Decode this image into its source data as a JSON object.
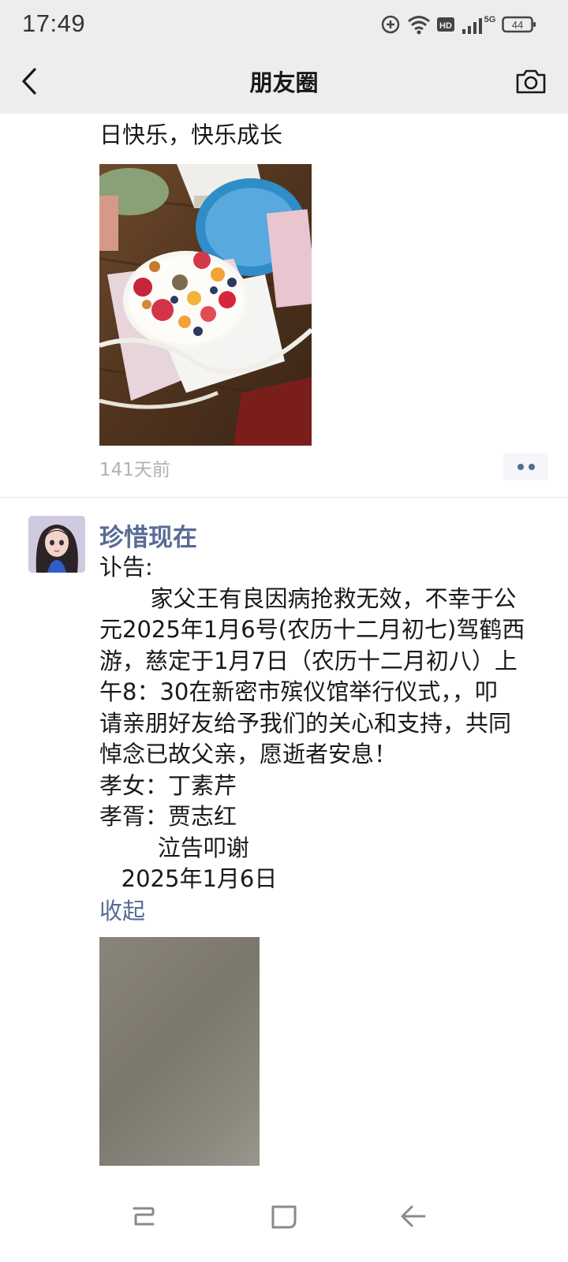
{
  "status_bar": {
    "time": "17:49",
    "network": "5G",
    "hd": "HD",
    "battery": "44"
  },
  "nav": {
    "title": "朋友圈"
  },
  "prev_post": {
    "text_tail": "日快乐，快乐成长",
    "time": "141天前"
  },
  "post": {
    "author": "珍惜现在",
    "lines": [
      "讣告:",
      "       家父王有良因病抢救无效，不幸于公",
      "元2025年1月6号(农历十二月初七)驾鹤西",
      "游，慈定于1月7日（农历十二月初八）上",
      "午8：30在新密市殡仪馆举行仪式，，叩",
      "请亲朋好友给予我们的关心和支持，共同",
      "悼念已故父亲，愿逝者安息！",
      "孝女：丁素芹",
      "孝胥：贾志红",
      "        泣告叩谢",
      "   2025年1月6日"
    ],
    "collapse_label": "收起"
  },
  "colors": {
    "link": "#576b95",
    "bar_bg": "#ededed",
    "time_gray": "#b2b2b2"
  }
}
